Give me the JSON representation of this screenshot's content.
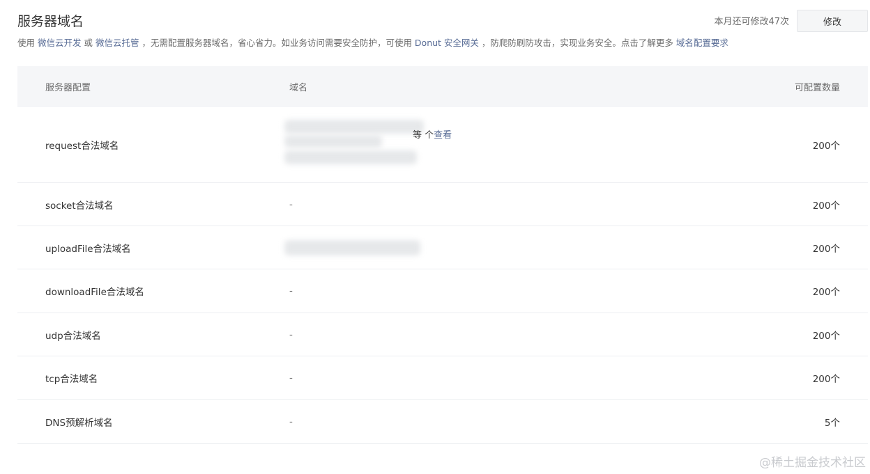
{
  "header": {
    "title": "服务器域名",
    "quota_text": "本月还可修改47次",
    "modify_label": "修改"
  },
  "description": {
    "p1": "使用 ",
    "link1": "微信云开发",
    "p2": " 或 ",
    "link2": "微信云托管",
    "p3": " ，无需配置服务器域名，省心省力。如业务访问需要安全防护，可使用 ",
    "link3": "Donut 安全网关",
    "p4": " ，防爬防刷防攻击，实现业务安全。点击了解更多 ",
    "link4": "域名配置要求"
  },
  "table": {
    "headers": {
      "config": "服务器配置",
      "domain": "域名",
      "count": "可配置数量"
    },
    "rows": [
      {
        "name": "request合法域名",
        "domain": "",
        "count": "200个"
      },
      {
        "name": "socket合法域名",
        "domain": "-",
        "count": "200个"
      },
      {
        "name": "uploadFile合法域名",
        "domain": "",
        "count": "200个"
      },
      {
        "name": "downloadFile合法域名",
        "domain": "-",
        "count": "200个"
      },
      {
        "name": "udp合法域名",
        "domain": "-",
        "count": "200个"
      },
      {
        "name": "tcp合法域名",
        "domain": "-",
        "count": "200个"
      },
      {
        "name": "DNS预解析域名",
        "domain": "-",
        "count": "5个"
      }
    ],
    "request_more_prefix": "等 ",
    "request_more_mid": "个",
    "request_more_link": "查看"
  },
  "watermark": "@稀土掘金技术社区"
}
